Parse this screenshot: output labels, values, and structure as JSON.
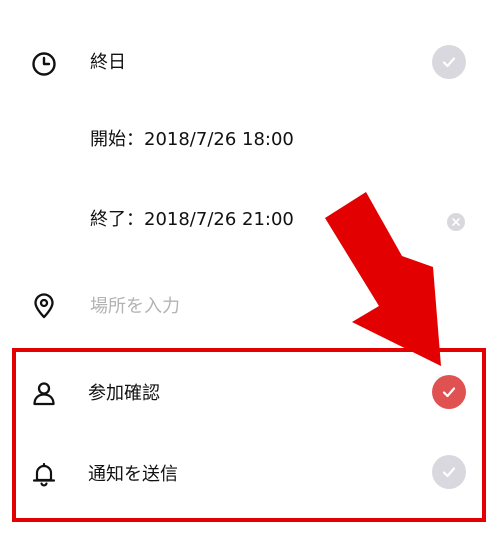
{
  "allday": {
    "label": "終日",
    "checked": false
  },
  "start": {
    "text": "開始：2018/7/26 18:00"
  },
  "end": {
    "text": "終了：2018/7/26 21:00"
  },
  "location": {
    "placeholder": "場所を入力",
    "value": ""
  },
  "attendance": {
    "label": "参加確認",
    "checked": true
  },
  "notify": {
    "label": "通知を送信",
    "checked": false
  },
  "icons": {
    "allday": "clock-icon",
    "location": "map-pin-icon",
    "attendance": "person-icon",
    "notify": "bell-icon",
    "clear": "clear-x-icon",
    "check": "checkmark-icon"
  },
  "colors": {
    "check_on": "#e05252",
    "check_off": "#d8d8de",
    "annotation_red": "#e20000",
    "placeholder": "#b3b3b3"
  }
}
